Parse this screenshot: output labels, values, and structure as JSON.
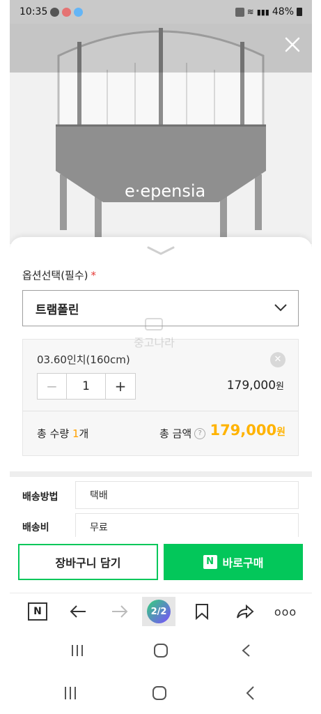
{
  "status_bar": {
    "time": "10:35",
    "battery": "48%"
  },
  "product_image": {
    "brand_text": "epensia"
  },
  "options": {
    "title": "옵션선택(필수)",
    "required_mark": "*",
    "selected": "트램폴린"
  },
  "cart_item": {
    "name": "03.60인치(160cm)",
    "quantity": "1",
    "price": "179,000",
    "currency": "원"
  },
  "totals": {
    "qty_label": "총 수량",
    "qty_value": "1",
    "qty_unit": "개",
    "amount_label": "총 금액",
    "help_mark": "?",
    "amount": "179,000",
    "currency": "원"
  },
  "watermark": {
    "text": "중고나라"
  },
  "shipping": [
    {
      "label": "배송방법",
      "value": "택배"
    },
    {
      "label": "배송비",
      "value": "무료"
    }
  ],
  "actions": {
    "cart_label": "장바구니 담기",
    "buy_label": "바로구매",
    "pay_badge": "N"
  },
  "browser_bar": {
    "home_badge": "N",
    "tab_count": "2/2",
    "more": "ooo"
  },
  "colors": {
    "accent_green": "#03c75a",
    "price_orange": "#ffb300",
    "required_red": "#e53935"
  }
}
